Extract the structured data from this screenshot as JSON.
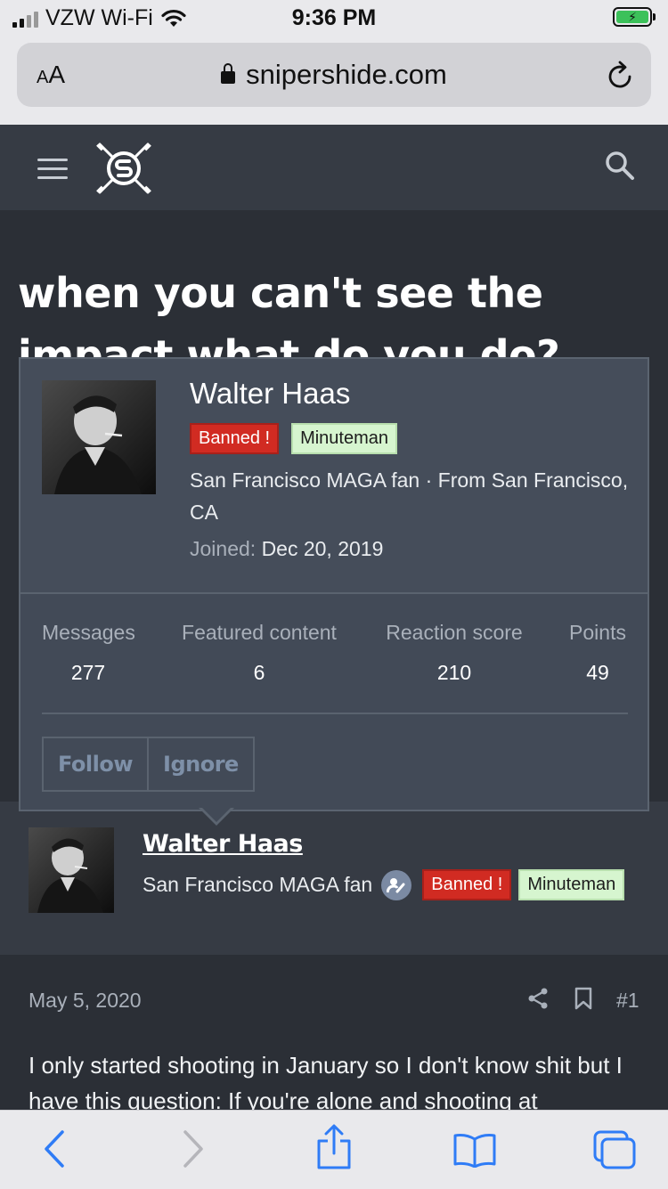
{
  "status_bar": {
    "carrier": "VZW Wi-Fi",
    "time": "9:36 PM"
  },
  "browser": {
    "text_size_label": "AA",
    "url": "snipershide.com"
  },
  "site_header": {
    "logo_name": "snipershide-logo"
  },
  "thread": {
    "title": "when you can't see the impact what do you do?"
  },
  "member_tooltip": {
    "name": "Walter Haas",
    "badges": [
      "Banned !",
      "Minuteman"
    ],
    "info": "San Francisco MAGA fan · From San Francisco, CA",
    "joined_label": "Joined:",
    "joined_value": "Dec 20, 2019",
    "stats": [
      {
        "label": "Messages",
        "value": "277"
      },
      {
        "label": "Featured content",
        "value": "6"
      },
      {
        "label": "Reaction score",
        "value": "210"
      },
      {
        "label": "Points",
        "value": "49"
      }
    ],
    "actions": [
      "Follow",
      "Ignore"
    ]
  },
  "author": {
    "name": "Walter Haas",
    "title": "San Francisco MAGA fan",
    "badges": [
      "Banned !",
      "Minuteman"
    ]
  },
  "post": {
    "date": "May 5, 2020",
    "number": "#1",
    "body": "I only started shooting in January so I don't know shit but I have this question: If you're alone and shooting at"
  },
  "colors": {
    "page_bg": "#2b2f36",
    "header_bg": "#363b44",
    "banned_badge": "#d12b22",
    "minuteman_badge": "#d6f5cf",
    "ios_accent": "#2f7cf6"
  }
}
